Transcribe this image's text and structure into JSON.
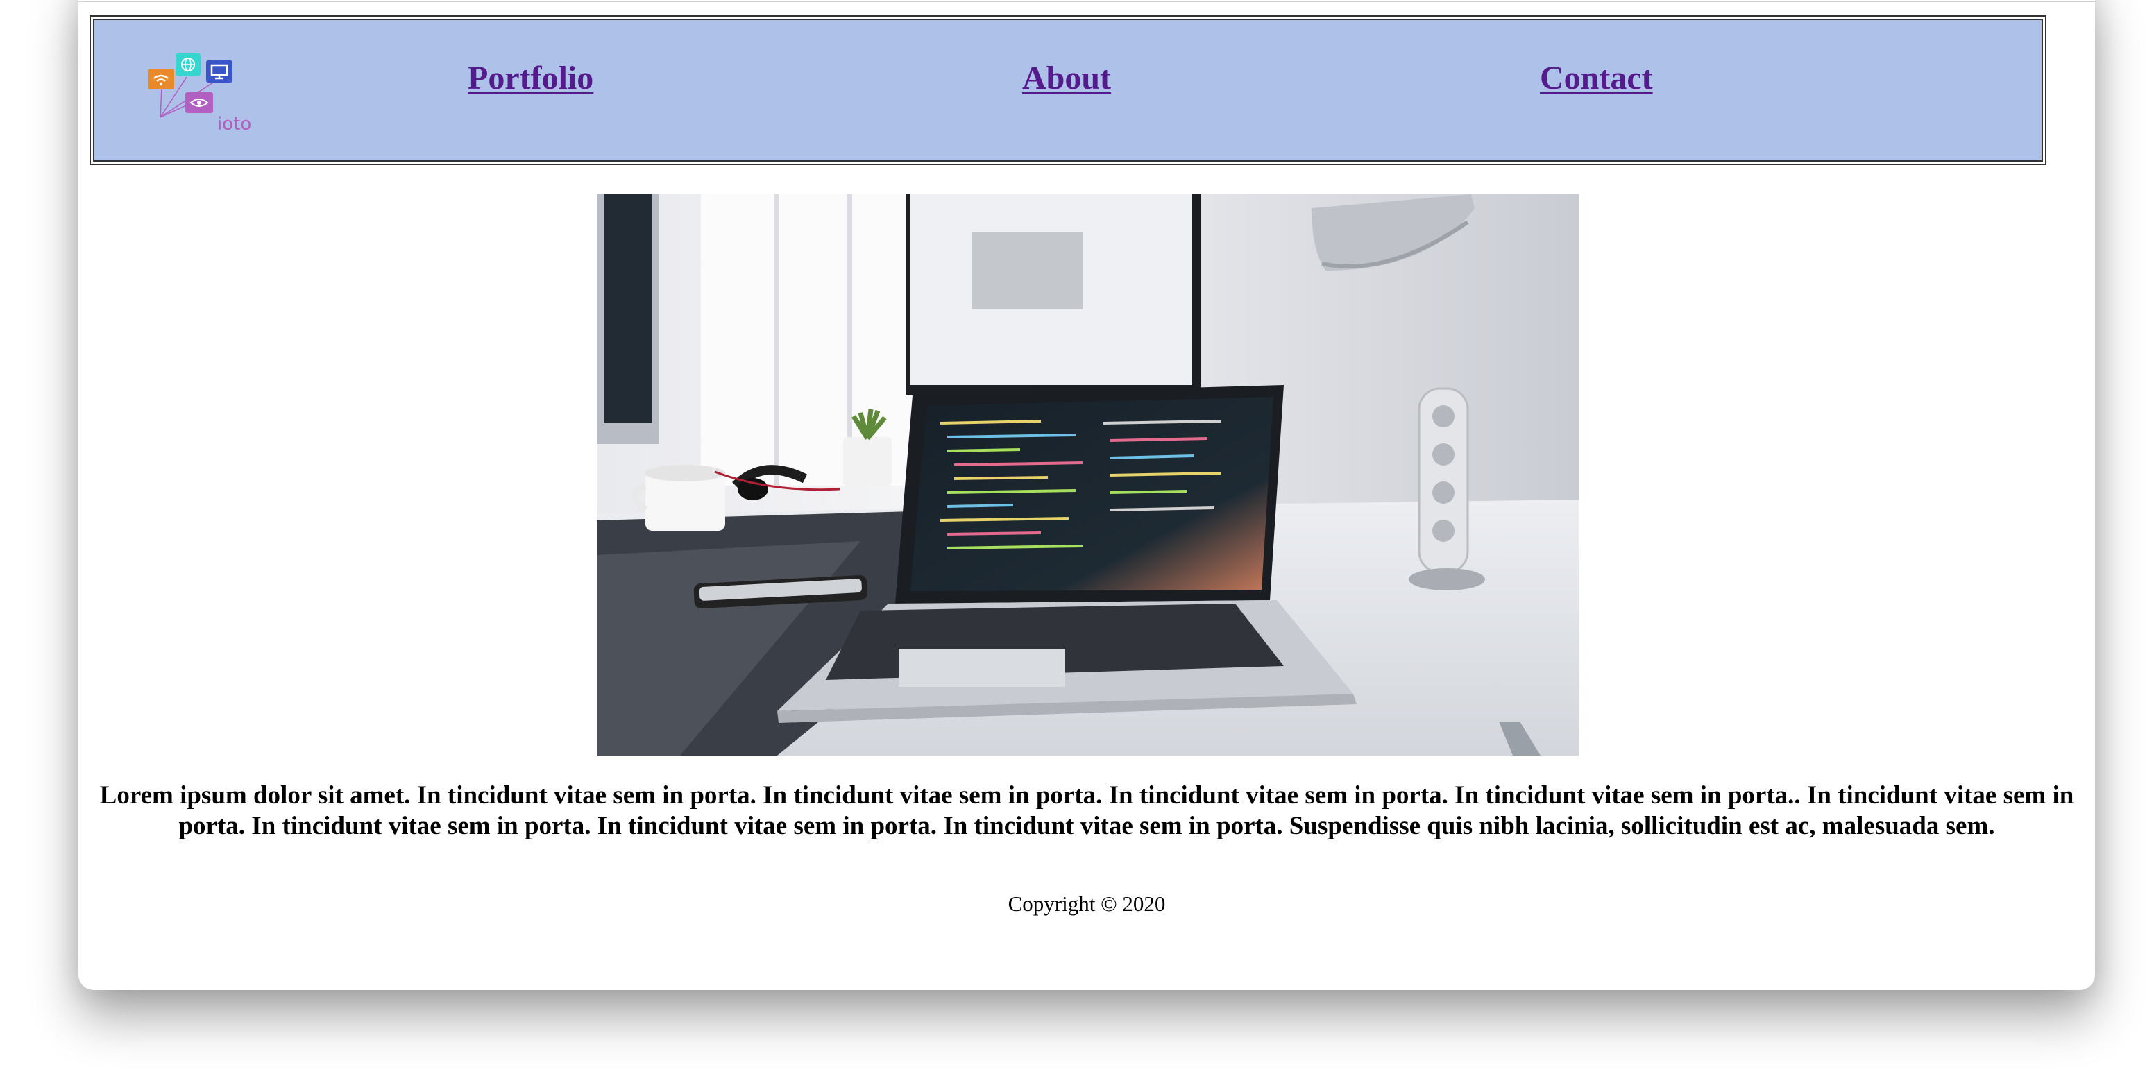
{
  "header": {
    "logo_text": "ioto",
    "nav": {
      "portfolio": "Portfolio",
      "about": "About",
      "contact": "Contact"
    }
  },
  "main": {
    "paragraph": "Lorem ipsum dolor sit amet. In tincidunt vitae sem in porta. In tincidunt vitae sem in porta. In tincidunt vitae sem in porta. In tincidunt vitae sem in porta.. In tincidunt vitae sem in porta. In tincidunt vitae sem in porta. In tincidunt vitae sem in porta. In tincidunt vitae sem in porta. Suspendisse quis nibh lacinia, sollicitudin est ac, malesuada sem."
  },
  "footer": {
    "copyright": "Copyright © 2020"
  },
  "colors": {
    "nav_background": "#adc1e9",
    "link_visited": "#551a8b",
    "logo_orange": "#e8892a",
    "logo_teal": "#35d6d0",
    "logo_blue": "#3a55c8",
    "logo_purple": "#b15fc1"
  },
  "icons": [
    "wifi-icon",
    "globe-icon",
    "monitor-icon",
    "eye-icon"
  ]
}
